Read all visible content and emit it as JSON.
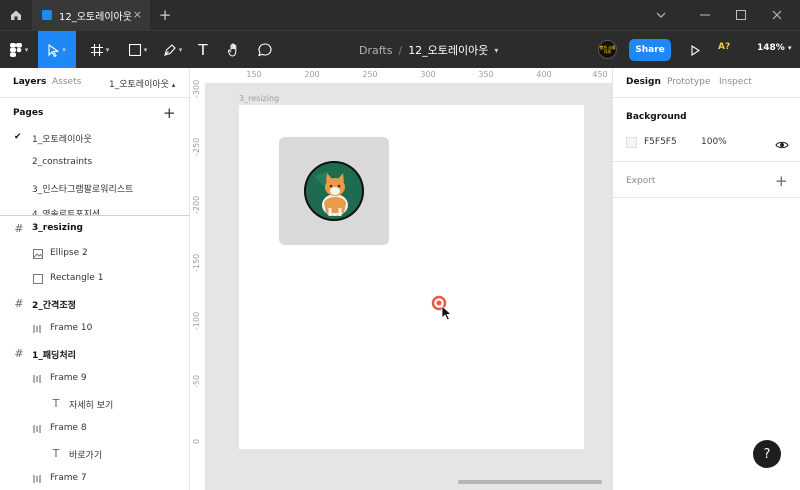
{
  "titlebar": {
    "tab_title": "12_오토레이아웃",
    "close_glyph": "×",
    "add_tab_glyph": "+"
  },
  "toolbar": {
    "breadcrumb_drafts": "Drafts",
    "breadcrumb_sep": "/",
    "file_name": "12_오토레이아웃",
    "share_label": "Share",
    "a_label": "A?",
    "zoom_label": "148%",
    "avatar_text": "빵가 스튜디오",
    "text_tool_glyph": "T",
    "active_tool": "move"
  },
  "left_panel": {
    "tab_layers": "Layers",
    "tab_assets": "Assets",
    "page_select": "1_오토레이아웃",
    "pages_heading": "Pages",
    "pages_add": "+",
    "current_page_check": "✔",
    "pages": [
      {
        "label": "1_오토레이아웃"
      },
      {
        "label": "2_constraints"
      },
      {
        "label": "3_인스타그램팔로워리스트"
      },
      {
        "label": "4_영솔로트포지션"
      }
    ],
    "layers": [
      {
        "label": "3_resizing",
        "icon": "#",
        "kind": "frame"
      },
      {
        "label": "Ellipse 2",
        "icon": "image",
        "kind": "child"
      },
      {
        "label": "Rectangle 1",
        "icon": "rect",
        "kind": "child"
      },
      {
        "label": "2_간격조정",
        "icon": "#",
        "kind": "frame"
      },
      {
        "label": "Frame 10",
        "icon": "autolayout",
        "kind": "child"
      },
      {
        "label": "1_패딩처리",
        "icon": "#",
        "kind": "frame"
      },
      {
        "label": "Frame 9",
        "icon": "autolayout",
        "kind": "child"
      },
      {
        "label": "자세히 보기",
        "icon": "T",
        "kind": "grandchild"
      },
      {
        "label": "Frame 8",
        "icon": "autolayout",
        "kind": "child"
      },
      {
        "label": "바로가기",
        "icon": "T",
        "kind": "grandchild"
      },
      {
        "label": "Frame 7",
        "icon": "autolayout",
        "kind": "child"
      }
    ]
  },
  "canvas": {
    "frame_name": "3_resizing",
    "ruler_top": [
      "150",
      "200",
      "250",
      "300",
      "350",
      "400",
      "450"
    ],
    "ruler_left": [
      "-300",
      "-250",
      "-200",
      "-150",
      "-100",
      "-50",
      "0"
    ],
    "frame_bg": "#ffffff",
    "rect_color": "#d9d9d9"
  },
  "right_panel": {
    "tab_design": "Design",
    "tab_prototype": "Prototype",
    "tab_inspect": "Inspect",
    "background_heading": "Background",
    "background_hex": "F5F5F5",
    "background_opacity": "100%",
    "export_label": "Export",
    "export_add": "+",
    "help_label": "?"
  },
  "colors": {
    "accent": "#1e88f5",
    "chrome_dark": "#2c2c2c",
    "canvas_bg": "#e5e5e5"
  }
}
